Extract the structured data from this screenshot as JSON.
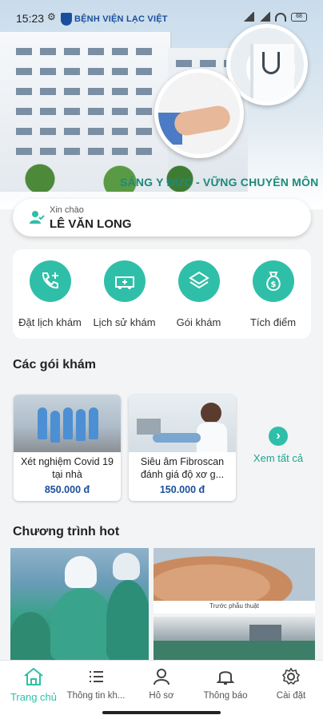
{
  "status_bar": {
    "time": "15:23",
    "brand": "BỆNH VIỆN LẠC VIỆT",
    "battery": "68"
  },
  "hero": {
    "slogan": "SÁNG Y ĐỨC - VỮNG CHUYÊN MÔN"
  },
  "greeting": {
    "hello": "Xin chào",
    "name": "LÊ VĂN LONG",
    "icon": "user-check-icon"
  },
  "quick_actions": [
    {
      "label": "Đặt lịch khám",
      "icon": "phone-plus-icon"
    },
    {
      "label": "Lịch sử khám",
      "icon": "ambulance-icon"
    },
    {
      "label": "Gói khám",
      "icon": "layers-icon"
    },
    {
      "label": "Tích điểm",
      "icon": "money-bag-icon"
    }
  ],
  "packages": {
    "title": "Các gói khám",
    "items": [
      {
        "title": "Xét nghiệm Covid 19 tại nhà",
        "price": "850.000 đ"
      },
      {
        "title": "Siêu âm Fibroscan đánh giá độ xơ g...",
        "price": "150.000 đ"
      }
    ],
    "see_all": "Xem tất cả"
  },
  "hot": {
    "title": "Chương trình hot",
    "caption": "Trước phẫu thuật"
  },
  "nav": [
    {
      "label": "Trang chủ",
      "icon": "home-icon",
      "active": true
    },
    {
      "label": "Thông tin kh...",
      "icon": "list-icon",
      "active": false
    },
    {
      "label": "Hồ sơ",
      "icon": "profile-icon",
      "active": false
    },
    {
      "label": "Thông báo",
      "icon": "bell-icon",
      "active": false
    },
    {
      "label": "Cài đặt",
      "icon": "settings-icon",
      "active": false
    }
  ],
  "colors": {
    "accent": "#2fbfa8",
    "brand_blue": "#1a4e9c",
    "slogan_green": "#1c8a7a"
  }
}
